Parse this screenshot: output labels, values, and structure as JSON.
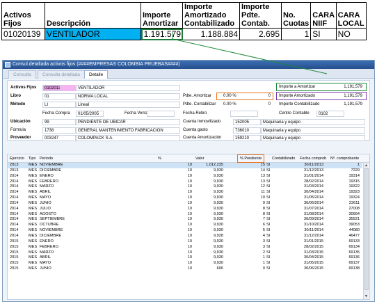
{
  "sheet": {
    "headers": [
      "Activos Fijos",
      "Descripción",
      "Importe Amortizar",
      "Importe Amortizado Contabilizado",
      "Importe Pdte. Contab.",
      "No. Cuotas",
      "CARA NIIF",
      "CARA LOCAL"
    ],
    "row": [
      "01020139",
      "VENTILADOR",
      "1.191.579",
      "1.188.884",
      "2.695",
      "1",
      "SI",
      "NO"
    ]
  },
  "window": {
    "title": "Consul.detallada activos fijos (####EMPRESAS COLOMBIA PRUEBAS####)",
    "tabs": [
      "Consulta",
      "Consulta detallada",
      "Detalle"
    ]
  },
  "form": {
    "activos_fijos_label": "Activos Fijos",
    "activo_code": "01020139",
    "activo_desc": "VENTILADOR",
    "libro_label": "Libro",
    "libro_code": "01",
    "libro_desc": "NORMA LOCAL",
    "metodo_label": "Método",
    "metodo_code": "LI",
    "metodo_desc": "Lineal",
    "pdte_amortizar_label": "Pdte. Amortizar",
    "pdte_amortizar_pct": "0.00 %",
    "pdte_amortizar_val": "0",
    "pdte_contabilizar_label": "Pdte. Contabilizar",
    "pdte_contabilizar_pct": "0.00 %",
    "pdte_contabilizar_val": "0",
    "importe_amortizar_label": "Importe a Amortizar",
    "importe_amortizar_val": "1,191,579",
    "importe_amortizado_label": "Importe Amortizado",
    "importe_amortizado_val": "1,191,579",
    "importe_contabilizado_label": "Importe Contabilizado",
    "importe_contabilizado_val": "1,191,579",
    "fecha_compra_label": "Fecha Compra",
    "fecha_compra_val": "01/05/2005",
    "fecha_venta_label": "Fecha Venta",
    "fecha_retiro_label": "Fecha Retiro",
    "centro_contable_label": "Centro Contable",
    "centro_contable_val": "0102",
    "ubicacion_label": "Ubicación",
    "ubicacion_code": "99",
    "ubicacion_desc": "PENDIENTE DE UBICAR",
    "formula_label": "Fórmula",
    "formula_code": "1738",
    "formula_desc": "GENERAL MANTENIMIENTO FABRICACION",
    "proveedor_label": "Proveedor",
    "proveedor_code": "003247",
    "proveedor_desc": "COLOMPACK S.A.",
    "cuenta_inmovilizado_label": "Cuenta Inmovilizado",
    "cuenta_inmovilizado_val": "152005",
    "cuenta_inmovilizado_desc": "Maquinaria y equipo",
    "cuenta_gasto_label": "Cuenta gasto",
    "cuenta_gasto_val": "736010",
    "cuenta_gasto_desc": "Maquinaria y equipo",
    "cuenta_amortizacion_label": "Cuenta Amortización",
    "cuenta_amortizacion_val": "159210",
    "cuenta_amortizacion_desc": "Maquinaria y equipo"
  },
  "grid": {
    "columns": [
      "Ejercicio",
      "Tipo",
      "Periodo",
      "%",
      "Valor",
      "% Pendiente",
      "Contabilizado",
      "Fecha comprob",
      "Nº. comprobante"
    ],
    "rows": [
      [
        "2013",
        "MES",
        "NOVIEMBRE",
        "10",
        "1,012,235",
        "15",
        "SI",
        "30/11/2013",
        "1"
      ],
      [
        "2013",
        "MES",
        "DICIEMBRE",
        "10",
        "9,930",
        "14",
        "SI",
        "31/12/2013",
        "7229"
      ],
      [
        "2014",
        "MES",
        "ENERO",
        "10",
        "9,930",
        "13",
        "SI",
        "31/01/2014",
        "19314"
      ],
      [
        "2014",
        "MES",
        "FEBRERO",
        "10",
        "9,930",
        "13",
        "SI",
        "28/02/2014",
        "19315"
      ],
      [
        "2014",
        "MES",
        "MARZO",
        "10",
        "9,930",
        "12",
        "SI",
        "31/03/2014",
        "19322"
      ],
      [
        "2014",
        "MES",
        "ABRIL",
        "10",
        "9,930",
        "11",
        "SI",
        "30/04/2014",
        "19323"
      ],
      [
        "2014",
        "MES",
        "MAYO",
        "10",
        "9,930",
        "10",
        "SI",
        "31/05/2014",
        "19324"
      ],
      [
        "2014",
        "MES",
        "JUNIO",
        "10",
        "9,930",
        "9",
        "SI",
        "30/06/2014",
        "23611"
      ],
      [
        "2014",
        "MES",
        "JULIO",
        "10",
        "9,930",
        "8",
        "SI",
        "31/07/2014",
        "27008"
      ],
      [
        "2014",
        "MES",
        "AGOSTO",
        "10",
        "9,930",
        "8",
        "SI",
        "31/08/2014",
        "30994"
      ],
      [
        "2014",
        "MES",
        "SEPTIEMBRE",
        "10",
        "9,930",
        "7",
        "SI",
        "30/09/2014",
        "35521"
      ],
      [
        "2014",
        "MES",
        "OCTUBRE",
        "10",
        "9,930",
        "6",
        "SI",
        "31/10/2014",
        "39053"
      ],
      [
        "2014",
        "MES",
        "NOVIEMBRE",
        "10",
        "9,930",
        "5",
        "SI",
        "30/11/2014",
        "44080"
      ],
      [
        "2014",
        "MES",
        "DICIEMBRE",
        "10",
        "9,928",
        "4",
        "SI",
        "31/12/2014",
        "46477"
      ],
      [
        "2015",
        "MES",
        "ENERO",
        "10",
        "9,930",
        "3",
        "SI",
        "31/01/2015",
        "69133"
      ],
      [
        "2015",
        "MES",
        "FEBRERO",
        "10",
        "9,930",
        "3",
        "SI",
        "28/02/2015",
        "69134"
      ],
      [
        "2015",
        "MES",
        "MARZO",
        "10",
        "9,930",
        "2",
        "SI",
        "31/03/2015",
        "69135"
      ],
      [
        "2015",
        "MES",
        "ABRIL",
        "10",
        "9,930",
        "1",
        "SI",
        "30/04/2015",
        "69136"
      ],
      [
        "2015",
        "MES",
        "MAYO",
        "10",
        "9,930",
        "1",
        "SI",
        "31/05/2015",
        "69137"
      ],
      [
        "2015",
        "MES",
        "JUNIO",
        "10",
        "606",
        "0",
        "SI",
        "30/06/2015",
        "69138"
      ]
    ]
  },
  "colors": {
    "highlight_cell": "#00b0f0",
    "green_box": "#1e8a3a",
    "orange_box": "#e9711c",
    "purple_box": "#7a3aa8",
    "code_field": "#e9a0e6"
  }
}
